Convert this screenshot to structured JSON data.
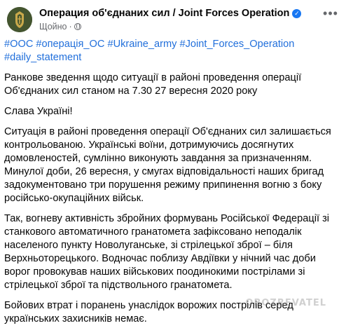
{
  "post": {
    "page_name": "Операция об'єднаних сил / Joint Forces Operation",
    "time": "Щойно",
    "hashtags": [
      "#ООС",
      "#операція_ОС",
      "#Ukraine_army",
      "#Joint_Forces_Operation",
      "#daily_statement"
    ],
    "paragraphs": [
      "Ранкове зведення щодо ситуації в районі проведення операції Об'єднаних сил станом на 7.30 27 вересня 2020 року",
      "Слава Україні!",
      "Ситуація в районі проведення операції Об'єднаних сил залишається контрольованою. Українські воїни, дотримуючись досягнутих домовленостей, сумлінно виконують завдання за призначенням.\nМинулої доби, 26 вересня, у смугах відповідальності наших бригад задокументовано три порушення режиму припинення вогню з боку російсько-окупаційних військ.",
      "Так, вогневу активність збройних формувань Російської Федерації зі станкового автоматичного гранатомета зафіксовано неподалік населеного пункту Новолуганське, зі стрілецької зброї – біля Верхньоторецького. Водночас поблизу Авдіївки у нічний час доби ворог провокував наших військових поодинокими пострілами зі стрілецької зброї та підствольного гранатомета.",
      "Бойових втрат і поранень унаслідок ворожих пострілів серед українських захисників немає."
    ]
  },
  "watermark": "OBOZREVATEL",
  "colors": {
    "link": "#216fdb",
    "verified": "#1877f2",
    "secondary_text": "#65676b"
  },
  "icons": [
    "avatar-emblem",
    "verified-badge-icon",
    "globe-icon",
    "more-options-icon"
  ]
}
